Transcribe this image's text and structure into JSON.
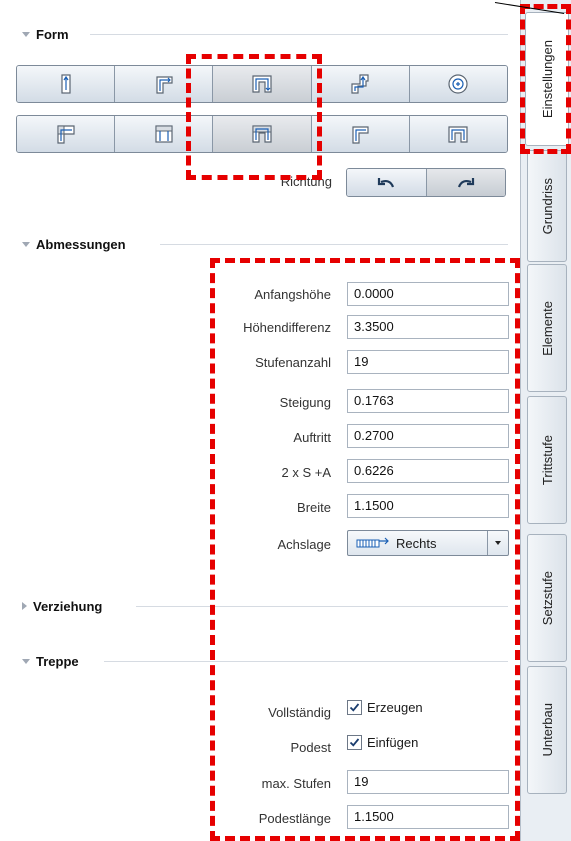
{
  "sections": {
    "form": "Form",
    "abmessungen": "Abmessungen",
    "verziehung": "Verziehung",
    "treppe": "Treppe"
  },
  "form": {
    "row1_icons": [
      "straight-stair-icon",
      "l-stair-icon",
      "u-stair-icon",
      "winder-stair-icon",
      "spiral-stair-icon"
    ],
    "row2_icons": [
      "l-stair-landing-icon",
      "double-stair-icon",
      "u-stair-landing-icon",
      "l-stair-alt-icon",
      "u-stair-alt-icon"
    ],
    "selected_index": 2
  },
  "richtung": {
    "label": "Richtung",
    "options": [
      "undo-arrow-icon",
      "redo-arrow-icon"
    ],
    "selected": 1
  },
  "abmessungen": {
    "anfangshoehe": {
      "label": "Anfangshöhe",
      "value": "0.0000"
    },
    "hoehendifferenz": {
      "label": "Höhendifferenz",
      "value": "3.3500"
    },
    "stufenanzahl": {
      "label": "Stufenanzahl",
      "value": "19"
    },
    "steigung": {
      "label": "Steigung",
      "value": "0.1763"
    },
    "auftritt": {
      "label": "Auftritt",
      "value": "0.2700"
    },
    "schrittmass": {
      "label": "2 x S +A",
      "value": "0.6226"
    },
    "breite": {
      "label": "Breite",
      "value": "1.1500"
    },
    "achslage": {
      "label": "Achslage",
      "value": "Rechts"
    }
  },
  "treppe": {
    "vollstaendig": {
      "label": "Vollständig",
      "check_label": "Erzeugen",
      "checked": true
    },
    "podest": {
      "label": "Podest",
      "check_label": "Einfügen",
      "checked": true
    },
    "max_stufen": {
      "label": "max. Stufen",
      "value": "19"
    },
    "podestlaenge": {
      "label": "Podestlänge",
      "value": "1.1500"
    }
  },
  "tabs": [
    "Einstellungen",
    "Grundriss",
    "Elemente",
    "Trittstufe",
    "Setzstufe",
    "Unterbau"
  ],
  "active_tab": "Einstellungen",
  "colors": {
    "highlight": "#e60000",
    "accent_blue": "#1a5fb4"
  }
}
